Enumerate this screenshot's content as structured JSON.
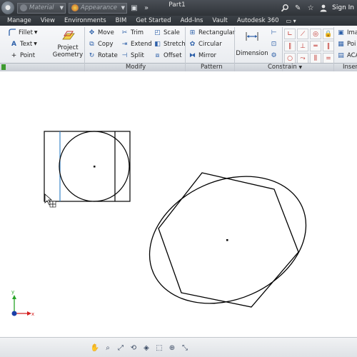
{
  "title_bar": {
    "app_icon": "autodesk-app-icon",
    "material_placeholder": "Material",
    "appearance_placeholder": "Appearance",
    "document_title": "Part1",
    "sign_in": "Sign In"
  },
  "menu_tabs": [
    "Manage",
    "View",
    "Environments",
    "BIM",
    "Get Started",
    "Add-Ins",
    "Vault",
    "Autodesk 360"
  ],
  "ribbon": {
    "draw": {
      "fillet": "Fillet",
      "text": "Text",
      "point": "Point"
    },
    "project_geometry": {
      "line1": "Project",
      "line2": "Geometry"
    },
    "modify": {
      "title": "Modify",
      "move": "Move",
      "trim": "Trim",
      "scale": "Scale",
      "copy": "Copy",
      "extend": "Extend",
      "stretch": "Stretch",
      "rotate": "Rotate",
      "split": "Split",
      "offset": "Offset"
    },
    "pattern": {
      "title": "Pattern",
      "rectangular": "Rectangular",
      "circular": "Circular",
      "mirror": "Mirror"
    },
    "dimension": "Dimension",
    "constrain": {
      "title": "Constrain"
    },
    "insert": {
      "title": "Insert",
      "image": "Ima",
      "points": "Poi",
      "acad": "ACA"
    }
  },
  "colors": {
    "titlebar": "#3a3f45",
    "ribbon": "#eef0f3",
    "constraint_red": "#c0312b",
    "axis_x": "#d42020",
    "axis_y": "#27a327",
    "origin_blue": "#1a3fa8",
    "construction_line": "#3a86c8",
    "sketch_line": "#000000"
  },
  "canvas": {
    "axis_x_label": "x",
    "axis_y_label": "y"
  }
}
